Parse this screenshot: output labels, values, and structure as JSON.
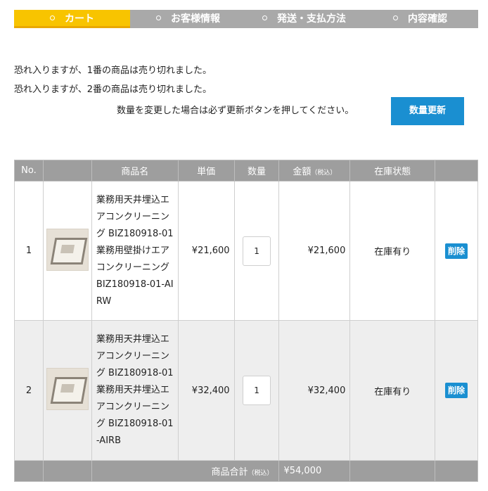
{
  "steps": [
    {
      "label": "カート",
      "active": true
    },
    {
      "label": "お客様情報",
      "active": false
    },
    {
      "label": "発送・支払方法",
      "active": false
    },
    {
      "label": "内容確認",
      "active": false
    }
  ],
  "messages": [
    "恐れ入りますが、1番の商品は売り切れました。",
    "恐れ入りますが、2番の商品は売り切れました。"
  ],
  "notice": "数量を変更した場合は必ず更新ボタンを押してください。",
  "update_button": "数量更新",
  "table": {
    "headers": {
      "no": "No.",
      "image": "",
      "name": "商品名",
      "unit_price": "単価",
      "quantity": "数量",
      "amount": "金額",
      "amount_tax": "（税込）",
      "stock": "在庫状態",
      "action": ""
    },
    "rows": [
      {
        "no": "1",
        "name": "業務用天井埋込エアコンクリーニング BIZ180918-01 業務用壁掛けエアコンクリーニング BIZ180918-01-AIRW",
        "unit_price": "¥21,600",
        "quantity": "1",
        "amount": "¥21,600",
        "stock": "在庫有り",
        "delete": "削除"
      },
      {
        "no": "2",
        "name": "業務用天井埋込エアコンクリーニング BIZ180918-01 業務用天井埋込エアコンクリーニング BIZ180918-01-AIRB",
        "unit_price": "¥32,400",
        "quantity": "1",
        "amount": "¥32,400",
        "stock": "在庫有り",
        "delete": "削除"
      }
    ],
    "total_label": "商品合計",
    "total_tax": "（税込）",
    "total_value": "¥54,000"
  },
  "colors": {
    "accent": "#f8c400",
    "step_inactive": "#a9a9a9",
    "button": "#1a8fd1",
    "header_bg": "#9e9e9e"
  }
}
